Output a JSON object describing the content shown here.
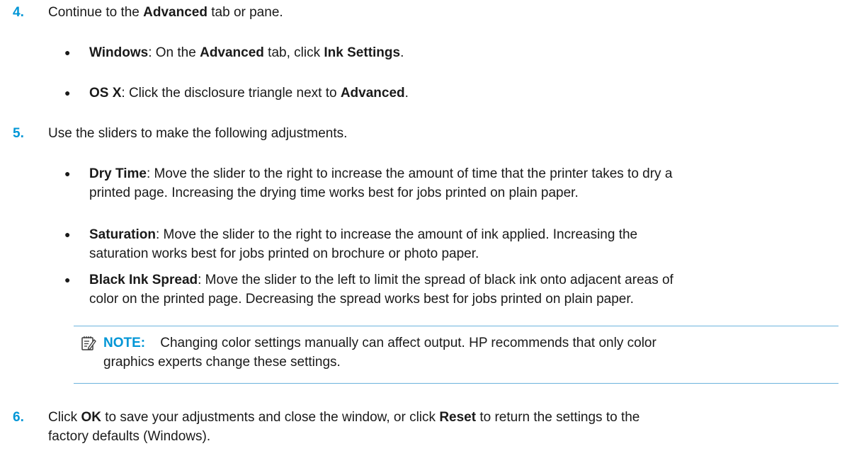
{
  "step4": {
    "num": "4.",
    "pre": "Continue to the ",
    "bold1": "Advanced",
    "post": " tab or pane.",
    "bullets": [
      {
        "label": "Windows",
        "text1": ": On the ",
        "bold2": "Advanced",
        "text2": " tab, click ",
        "bold3": "Ink Settings",
        "text3": "."
      },
      {
        "label": "OS X",
        "text1": ": Click the disclosure triangle next to ",
        "bold2": "Advanced",
        "text2": "."
      }
    ]
  },
  "step5": {
    "num": "5.",
    "text": "Use the sliders to make the following adjustments.",
    "bullets": [
      {
        "label": "Dry Time",
        "line1": ": Move the slider to the right to increase the amount of time that the printer takes to dry a",
        "line2": "printed page. Increasing the drying time works best for jobs printed on plain paper."
      },
      {
        "label": "Saturation",
        "line1": ": Move the slider to the right to increase the amount of ink applied. Increasing the",
        "line2": "saturation works best for jobs printed on brochure or photo paper."
      },
      {
        "label": "Black Ink Spread",
        "line1": ": Move the slider to the left to limit the spread of black ink onto adjacent areas of",
        "line2": "color on the printed page. Decreasing the spread works best for jobs printed on plain paper."
      }
    ]
  },
  "note": {
    "icon": "note-icon",
    "label": "NOTE:",
    "line1": "Changing color settings manually can affect output. HP recommends that only color",
    "line2": "graphics experts change these settings."
  },
  "step6": {
    "num": "6.",
    "pre": "Click ",
    "bold1": "OK",
    "mid": " to save your adjustments and close the window, or click ",
    "bold2": "Reset",
    "post": " to return the settings to the",
    "line2": "factory defaults (Windows)."
  },
  "colors": {
    "accent": "#0096d6",
    "note_rule": "#6cb4dd",
    "text": "#1a1a1a"
  }
}
